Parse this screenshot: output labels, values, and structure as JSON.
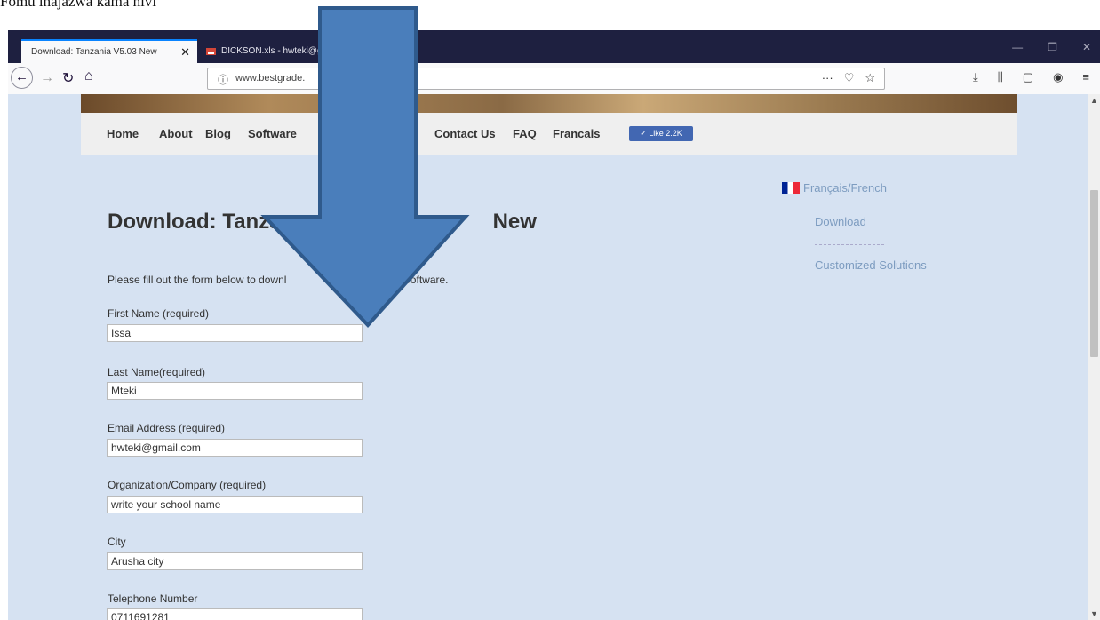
{
  "caption": "Fomu inajazwa kama hivi",
  "browser": {
    "tabs": [
      {
        "title": "Download: Tanzania V5.03 New",
        "close": "✕"
      },
      {
        "title": "DICKSON.xls - hwteki@gmail.com"
      }
    ],
    "url_domain": "www.bestgrade.",
    "url_icons": [
      "info-icon",
      "more-icon",
      "pocket-icon",
      "star-icon"
    ],
    "toolbar_icons": [
      "download-icon",
      "library-icon",
      "sidebar-icon",
      "account-icon",
      "menu-icon"
    ]
  },
  "site_nav": {
    "items": [
      "Home",
      "About",
      "Blog",
      "Software",
      "Contact Us",
      "FAQ",
      "Francais"
    ],
    "like_label": "✓ Like 2.2K"
  },
  "page": {
    "title": "Download: Tanza",
    "title_end": "New",
    "intro_start": "Please fill out the form below to downl",
    "intro_end": "rade Software."
  },
  "form": [
    {
      "label": "First Name (required)",
      "value": "Issa"
    },
    {
      "label": "Last Name(required)",
      "value": "Mteki"
    },
    {
      "label": "Email Address (required)",
      "value": "hwteki@gmail.com"
    },
    {
      "label": "Organization/Company (required)",
      "value": "write your school name"
    },
    {
      "label": "City",
      "value": "Arusha city"
    },
    {
      "label": "Telephone Number",
      "value": "0711691281"
    }
  ],
  "sidebar": {
    "heading": "Français/French",
    "links": [
      "Download",
      "Customized Solutions"
    ]
  },
  "colors": {
    "arrow_fill": "#4a7ebb",
    "arrow_stroke": "#2f5a8c",
    "page_background": "#d6e2f2"
  }
}
